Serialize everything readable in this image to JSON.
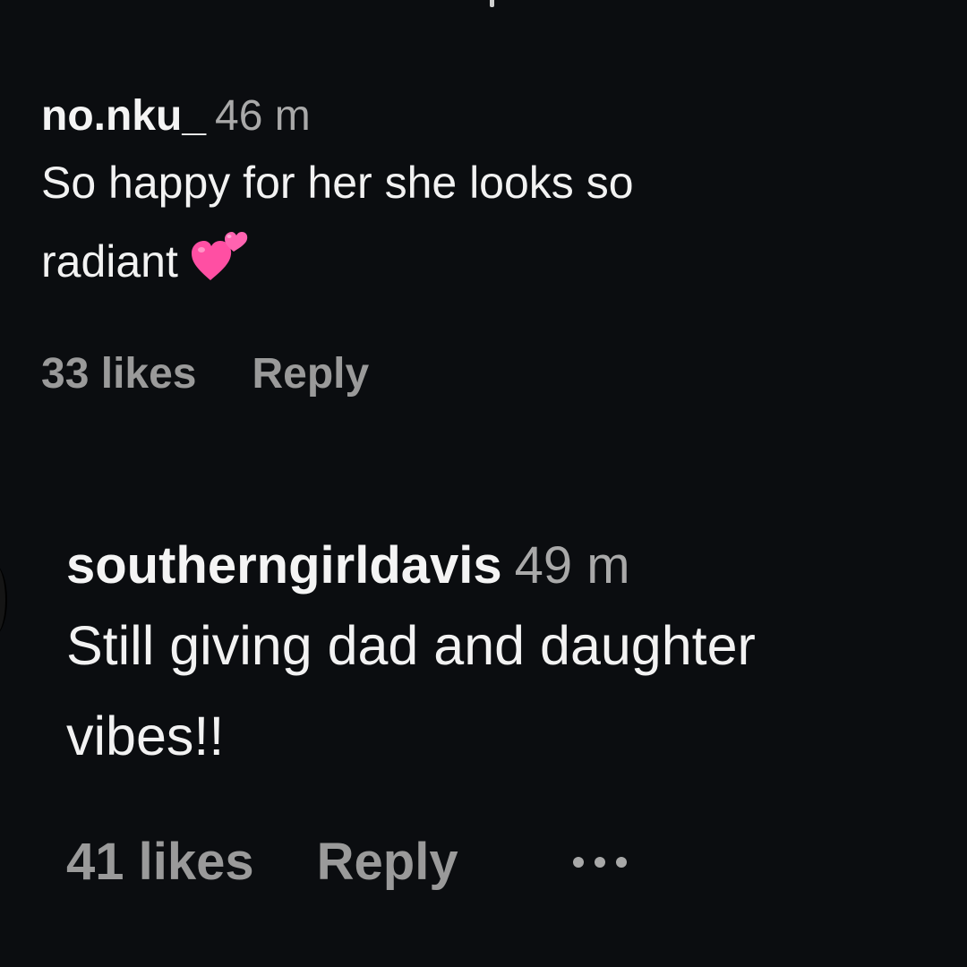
{
  "comments": [
    {
      "username": "no.nku_",
      "time": "46 m",
      "text_line1": "So happy for her she looks so",
      "text_line2": "radiant",
      "emoji": "two-hearts-icon",
      "likes": "33 likes",
      "reply": "Reply"
    },
    {
      "username": "southerngirldavis",
      "time": "49 m",
      "text_line1": "Still giving dad and daughter",
      "text_line2": "vibes!!",
      "likes": "41 likes",
      "reply": "Reply",
      "more_icon": "more-options-icon"
    }
  ],
  "colors": {
    "background": "#0b0d10",
    "text": "#f2f2f2",
    "muted": "#9a9a9a",
    "heart": "#ff4fa3"
  }
}
